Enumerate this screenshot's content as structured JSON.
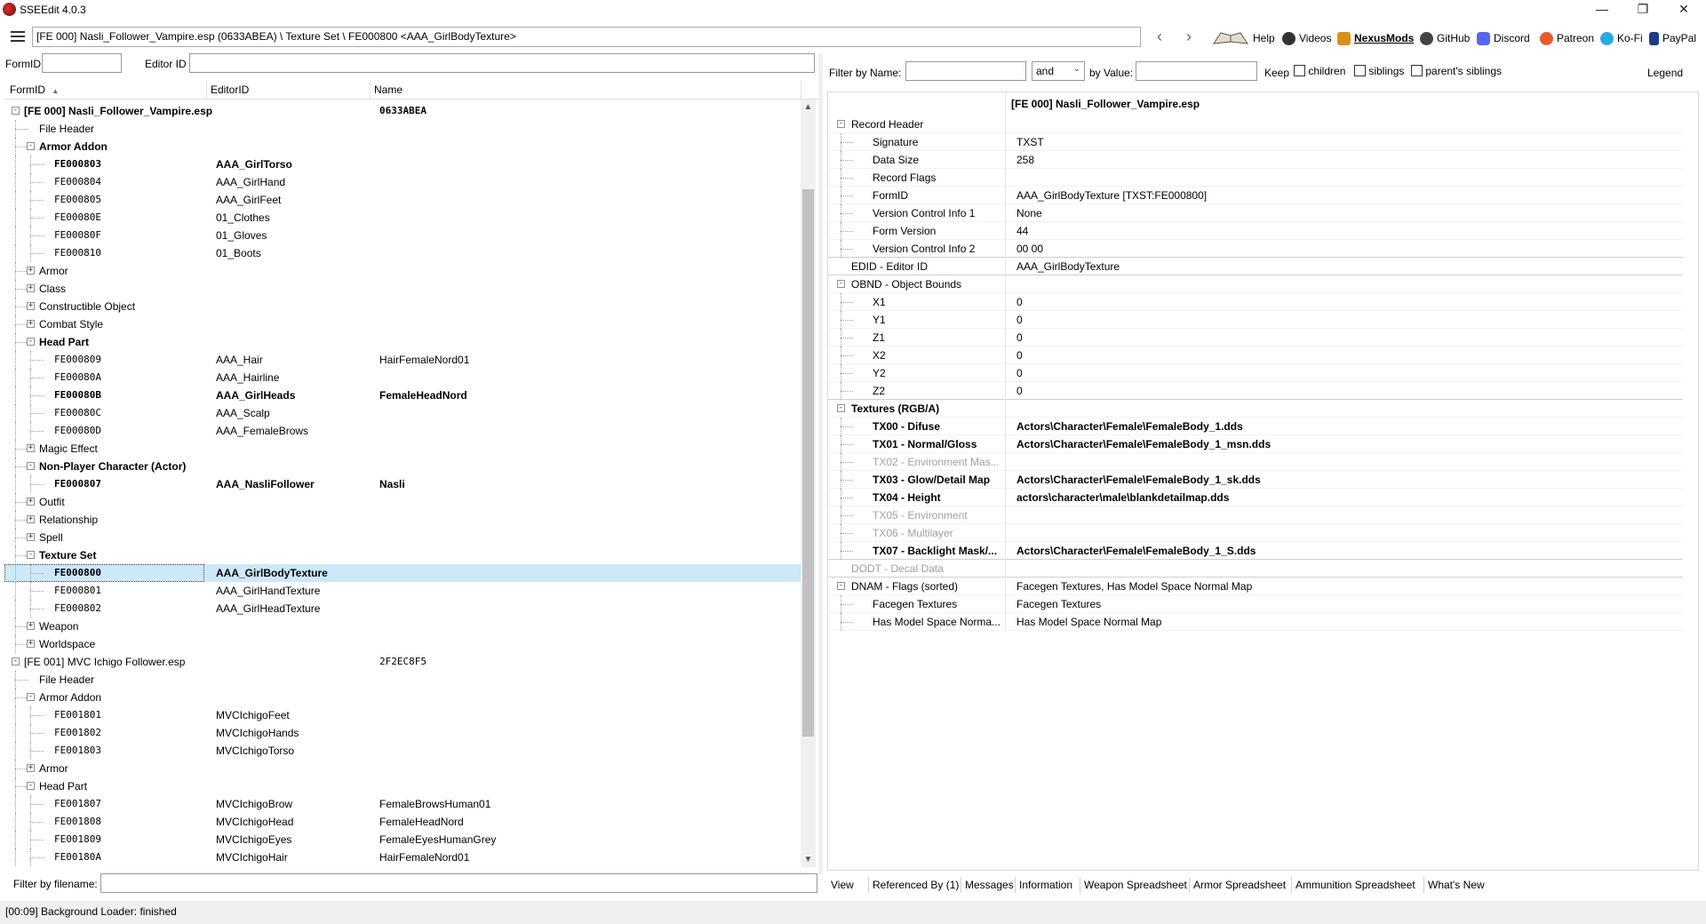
{
  "window": {
    "title": "SSEEdit 4.0.3",
    "controls": [
      "—",
      "❐",
      "✕"
    ]
  },
  "nav": {
    "path": "[FE 000] Nasli_Follower_Vampire.esp (0633ABEA) \\ Texture Set \\ FE000800 <AAA_GirlBodyTexture>",
    "back": "‹",
    "forward": "›",
    "links": [
      "Help",
      "Videos",
      "NexusMods",
      "GitHub",
      "Discord",
      "Patreon",
      "Ko-Fi",
      "PayPal"
    ]
  },
  "left": {
    "formid_label": "FormID",
    "editorid_label": "Editor ID",
    "columns": [
      "FormID",
      "EditorID",
      "Name"
    ],
    "sort_indicator": "▲",
    "filter_filename_label": "Filter by filename:"
  },
  "tree": [
    {
      "level": 0,
      "exp": "-",
      "formid": "[FE 000] Nasli_Follower_Vampire.esp",
      "editorid": "",
      "name": "0633ABEA",
      "bold": true,
      "mono": false,
      "namemono": true
    },
    {
      "level": 1,
      "exp": "",
      "formid": "File Header",
      "editorid": "",
      "name": ""
    },
    {
      "level": 1,
      "exp": "-",
      "formid": "Armor Addon",
      "editorid": "",
      "name": "",
      "bold": true
    },
    {
      "level": 2,
      "exp": "",
      "formid": "FE000803",
      "editorid": "AAA_GirlTorso",
      "name": "",
      "bold": true,
      "mono": true
    },
    {
      "level": 2,
      "exp": "",
      "formid": "FE000804",
      "editorid": "AAA_GirlHand",
      "name": "",
      "mono": true
    },
    {
      "level": 2,
      "exp": "",
      "formid": "FE000805",
      "editorid": "AAA_GirlFeet",
      "name": "",
      "mono": true
    },
    {
      "level": 2,
      "exp": "",
      "formid": "FE00080E",
      "editorid": "01_Clothes",
      "name": "",
      "mono": true
    },
    {
      "level": 2,
      "exp": "",
      "formid": "FE00080F",
      "editorid": "01_Gloves",
      "name": "",
      "mono": true
    },
    {
      "level": 2,
      "exp": "",
      "formid": "FE000810",
      "editorid": "01_Boots",
      "name": "",
      "mono": true
    },
    {
      "level": 1,
      "exp": "+",
      "formid": "Armor",
      "editorid": "",
      "name": ""
    },
    {
      "level": 1,
      "exp": "+",
      "formid": "Class",
      "editorid": "",
      "name": ""
    },
    {
      "level": 1,
      "exp": "+",
      "formid": "Constructible Object",
      "editorid": "",
      "name": ""
    },
    {
      "level": 1,
      "exp": "+",
      "formid": "Combat Style",
      "editorid": "",
      "name": ""
    },
    {
      "level": 1,
      "exp": "-",
      "formid": "Head Part",
      "editorid": "",
      "name": "",
      "bold": true
    },
    {
      "level": 2,
      "exp": "",
      "formid": "FE000809",
      "editorid": "AAA_Hair",
      "name": "HairFemaleNord01",
      "mono": true
    },
    {
      "level": 2,
      "exp": "",
      "formid": "FE00080A",
      "editorid": "AAA_Hairline",
      "name": "",
      "mono": true
    },
    {
      "level": 2,
      "exp": "",
      "formid": "FE00080B",
      "editorid": "AAA_GirlHeads",
      "name": "FemaleHeadNord",
      "bold": true,
      "mono": true
    },
    {
      "level": 2,
      "exp": "",
      "formid": "FE00080C",
      "editorid": "AAA_Scalp",
      "name": "",
      "mono": true
    },
    {
      "level": 2,
      "exp": "",
      "formid": "FE00080D",
      "editorid": "AAA_FemaleBrows",
      "name": "",
      "mono": true
    },
    {
      "level": 1,
      "exp": "+",
      "formid": "Magic Effect",
      "editorid": "",
      "name": ""
    },
    {
      "level": 1,
      "exp": "-",
      "formid": "Non-Player Character (Actor)",
      "editorid": "",
      "name": "",
      "bold": true
    },
    {
      "level": 2,
      "exp": "",
      "formid": "FE000807",
      "editorid": "AAA_NasliFollower",
      "name": "Nasli",
      "bold": true,
      "mono": true
    },
    {
      "level": 1,
      "exp": "+",
      "formid": "Outfit",
      "editorid": "",
      "name": ""
    },
    {
      "level": 1,
      "exp": "+",
      "formid": "Relationship",
      "editorid": "",
      "name": ""
    },
    {
      "level": 1,
      "exp": "+",
      "formid": "Spell",
      "editorid": "",
      "name": ""
    },
    {
      "level": 1,
      "exp": "-",
      "formid": "Texture Set",
      "editorid": "",
      "name": "",
      "bold": true
    },
    {
      "level": 2,
      "exp": "",
      "formid": "FE000800",
      "editorid": "AAA_GirlBodyTexture",
      "name": "",
      "bold": true,
      "mono": true,
      "selected": true
    },
    {
      "level": 2,
      "exp": "",
      "formid": "FE000801",
      "editorid": "AAA_GirlHandTexture",
      "name": "",
      "mono": true
    },
    {
      "level": 2,
      "exp": "",
      "formid": "FE000802",
      "editorid": "AAA_GirlHeadTexture",
      "name": "",
      "mono": true
    },
    {
      "level": 1,
      "exp": "+",
      "formid": "Weapon",
      "editorid": "",
      "name": ""
    },
    {
      "level": 1,
      "exp": "+",
      "formid": "Worldspace",
      "editorid": "",
      "name": ""
    },
    {
      "level": 0,
      "exp": "-",
      "formid": "[FE 001] MVC Ichigo Follower.esp",
      "editorid": "",
      "name": "2F2EC8F5",
      "namemono": true
    },
    {
      "level": 1,
      "exp": "",
      "formid": "File Header",
      "editorid": "",
      "name": ""
    },
    {
      "level": 1,
      "exp": "-",
      "formid": "Armor Addon",
      "editorid": "",
      "name": ""
    },
    {
      "level": 2,
      "exp": "",
      "formid": "FE001801",
      "editorid": "MVCIchigoFeet",
      "name": "",
      "mono": true
    },
    {
      "level": 2,
      "exp": "",
      "formid": "FE001802",
      "editorid": "MVCIchigoHands",
      "name": "",
      "mono": true
    },
    {
      "level": 2,
      "exp": "",
      "formid": "FE001803",
      "editorid": "MVCIchigoTorso",
      "name": "",
      "mono": true
    },
    {
      "level": 1,
      "exp": "+",
      "formid": "Armor",
      "editorid": "",
      "name": ""
    },
    {
      "level": 1,
      "exp": "-",
      "formid": "Head Part",
      "editorid": "",
      "name": ""
    },
    {
      "level": 2,
      "exp": "",
      "formid": "FE001807",
      "editorid": "MVCIchigoBrow",
      "name": "FemaleBrowsHuman01",
      "mono": true
    },
    {
      "level": 2,
      "exp": "",
      "formid": "FE001808",
      "editorid": "MVCIchigoHead",
      "name": "FemaleHeadNord",
      "mono": true
    },
    {
      "level": 2,
      "exp": "",
      "formid": "FE001809",
      "editorid": "MVCIchigoEyes",
      "name": "FemaleEyesHumanGrey",
      "mono": true
    },
    {
      "level": 2,
      "exp": "",
      "formid": "FE00180A",
      "editorid": "MVCIchigoHair",
      "name": "HairFemaleNord01",
      "mono": true
    }
  ],
  "right": {
    "filter_name_label": "Filter by Name:",
    "op_value": "and",
    "by_value_label": "by Value:",
    "keep_label": "Keep",
    "children_label": "children",
    "siblings_label": "siblings",
    "parents_siblings_label": "parent's siblings",
    "legend_label": "Legend",
    "header_value": "[FE 000] Nasli_Follower_Vampire.esp"
  },
  "record": [
    {
      "level": 0,
      "exp": "-",
      "name": "Record Header",
      "value": ""
    },
    {
      "level": 1,
      "exp": "",
      "name": "Signature",
      "value": "TXST"
    },
    {
      "level": 1,
      "exp": "",
      "name": "Data Size",
      "value": "258"
    },
    {
      "level": 1,
      "exp": "",
      "name": "Record Flags",
      "value": ""
    },
    {
      "level": 1,
      "exp": "",
      "name": "FormID",
      "value": "AAA_GirlBodyTexture [TXST:FE000800]"
    },
    {
      "level": 1,
      "exp": "",
      "name": "Version Control Info 1",
      "value": "None"
    },
    {
      "level": 1,
      "exp": "",
      "name": "Form Version",
      "value": "44"
    },
    {
      "level": 1,
      "exp": "",
      "name": "Version Control Info 2",
      "value": "00 00",
      "sep": true
    },
    {
      "level": 0,
      "exp": "",
      "name": "EDID - Editor ID",
      "value": "AAA_GirlBodyTexture",
      "sep": true
    },
    {
      "level": 0,
      "exp": "-",
      "name": "OBND - Object Bounds",
      "value": ""
    },
    {
      "level": 1,
      "exp": "",
      "name": "X1",
      "value": "0"
    },
    {
      "level": 1,
      "exp": "",
      "name": "Y1",
      "value": "0"
    },
    {
      "level": 1,
      "exp": "",
      "name": "Z1",
      "value": "0"
    },
    {
      "level": 1,
      "exp": "",
      "name": "X2",
      "value": "0"
    },
    {
      "level": 1,
      "exp": "",
      "name": "Y2",
      "value": "0"
    },
    {
      "level": 1,
      "exp": "",
      "name": "Z2",
      "value": "0",
      "sep": true
    },
    {
      "level": 0,
      "exp": "-",
      "name": "Textures (RGB/A)",
      "value": "",
      "bold": true
    },
    {
      "level": 1,
      "exp": "",
      "name": "TX00 - Difuse",
      "value": "Actors\\Character\\Female\\FemaleBody_1.dds",
      "bold": true
    },
    {
      "level": 1,
      "exp": "",
      "name": "TX01 - Normal/Gloss",
      "value": "Actors\\Character\\Female\\FemaleBody_1_msn.dds",
      "bold": true
    },
    {
      "level": 1,
      "exp": "",
      "name": "TX02 - Environment Mas...",
      "value": "",
      "gray": true
    },
    {
      "level": 1,
      "exp": "",
      "name": "TX03 - Glow/Detail Map",
      "value": "Actors\\Character\\Female\\FemaleBody_1_sk.dds",
      "bold": true
    },
    {
      "level": 1,
      "exp": "",
      "name": "TX04 - Height",
      "value": "actors\\character\\male\\blankdetailmap.dds",
      "bold": true
    },
    {
      "level": 1,
      "exp": "",
      "name": "TX05 - Environment",
      "value": "",
      "gray": true
    },
    {
      "level": 1,
      "exp": "",
      "name": "TX06 - Multilayer",
      "value": "",
      "gray": true
    },
    {
      "level": 1,
      "exp": "",
      "name": "TX07 - Backlight Mask/...",
      "value": "Actors\\Character\\Female\\FemaleBody_1_S.dds",
      "bold": true,
      "sep": true
    },
    {
      "level": 0,
      "exp": "",
      "name": "DODT - Decal Data",
      "value": "",
      "gray": true,
      "sep": true
    },
    {
      "level": 0,
      "exp": "-",
      "name": "DNAM - Flags (sorted)",
      "value": "Facegen Textures, Has Model Space Normal Map"
    },
    {
      "level": 1,
      "exp": "",
      "name": "Facegen Textures",
      "value": "Facegen Textures"
    },
    {
      "level": 1,
      "exp": "",
      "name": "Has Model Space Norma...",
      "value": "Has Model Space Normal Map"
    }
  ],
  "tabs": [
    "View",
    "Referenced By (1)",
    "Messages",
    "Information",
    "Weapon Spreadsheet",
    "Armor Spreadsheet",
    "Ammunition Spreadsheet",
    "What's New"
  ],
  "status": "[00:09] Background Loader: finished",
  "colors": {
    "selection": "#cde8f7",
    "accent": "#0a64c8"
  }
}
